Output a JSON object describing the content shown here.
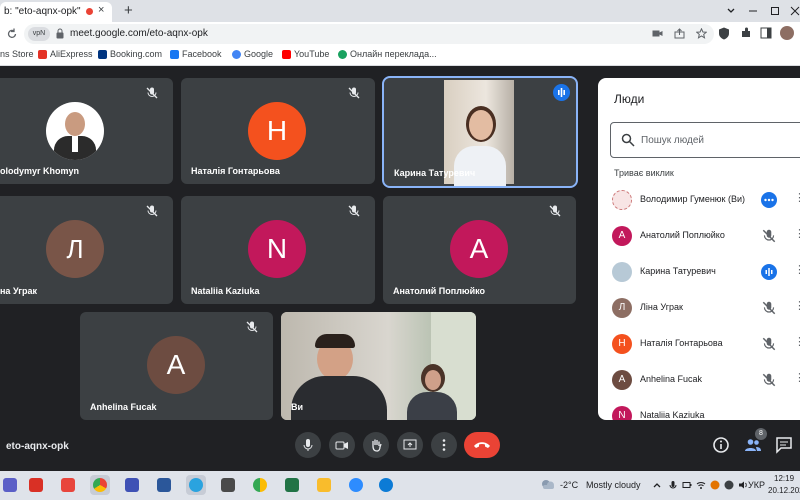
{
  "browser": {
    "tab_title": "b: \"eto-aqnx-opk\"",
    "new_tab_glyph": "+",
    "close_glyph": "×",
    "url": "meet.google.com/eto-aqnx-opk",
    "site_chip": "vpN",
    "bookmarks": [
      {
        "label": "ns Store",
        "color": "#ffffff"
      },
      {
        "label": "AliExpress",
        "color": "#e43226"
      },
      {
        "label": "Booking.com",
        "color": "#003580"
      },
      {
        "label": "Facebook",
        "color": "#1877f2"
      },
      {
        "label": "Google",
        "color": "#4285f4"
      },
      {
        "label": "YouTube",
        "color": "#ff0000"
      },
      {
        "label": "Онлайн перекладa...",
        "color": "#1aa260"
      }
    ]
  },
  "meet": {
    "meeting_code": "eto-aqnx-opk",
    "tiles": [
      {
        "name": "olodymyr Khomyn",
        "initial": "",
        "avatar_color": "#ffffff",
        "muted": true
      },
      {
        "name": "Наталія Гонтарьова",
        "initial": "H",
        "avatar_color": "#f4511e",
        "muted": true
      },
      {
        "name": "Карина Татуревич",
        "initial": "",
        "avatar_color": "",
        "muted": false,
        "speaking": true
      },
      {
        "name": "на Уграк",
        "initial": "Л",
        "avatar_color": "#795548",
        "muted": true
      },
      {
        "name": "Nataliia Kaziuka",
        "initial": "N",
        "avatar_color": "#c2185b",
        "muted": true
      },
      {
        "name": "Анатолий Поплюйко",
        "initial": "A",
        "avatar_color": "#c2185b",
        "muted": true
      },
      {
        "name": "Anhelina Fucak",
        "initial": "A",
        "avatar_color": "#6d4c41",
        "muted": true
      },
      {
        "name": "Ви",
        "initial": "",
        "avatar_color": "",
        "muted": false
      }
    ],
    "participant_count": "8"
  },
  "people_panel": {
    "title": "Люди",
    "search_placeholder": "Пошук людей",
    "section_label": "Триває виклик",
    "participants": [
      {
        "name": "Володимир Гуменюк (Ви)",
        "initial": "",
        "avatar_color": "#f8e5e5",
        "status": "more"
      },
      {
        "name": "Анатолий Поплюйко",
        "initial": "A",
        "avatar_color": "#c2185b",
        "status": "mic-off"
      },
      {
        "name": "Карина Татуревич",
        "initial": "",
        "avatar_color": "#b7c9d6",
        "status": "speaking"
      },
      {
        "name": "Ліна Уграк",
        "initial": "Л",
        "avatar_color": "#8d6e63",
        "status": "mic-off"
      },
      {
        "name": "Наталія Гонтарьова",
        "initial": "H",
        "avatar_color": "#f4511e",
        "status": "mic-off"
      },
      {
        "name": "Anhelina Fucak",
        "initial": "A",
        "avatar_color": "#6d4c41",
        "status": "mic-off"
      },
      {
        "name": "Nataliia Kaziuka",
        "initial": "N",
        "avatar_color": "#c2185b",
        "status": "mic-off"
      }
    ]
  },
  "taskbar": {
    "weather_temp": "-2°C",
    "weather_text": "Mostly cloudy",
    "language": "УКР",
    "time": "12:19",
    "date": "20.12.202",
    "apps": [
      {
        "name": "teams",
        "color": "#5b5fc7"
      },
      {
        "name": "app-red",
        "color": "#d93025"
      },
      {
        "name": "pdf",
        "color": "#e8453c"
      },
      {
        "name": "chrome",
        "color": "#34a853"
      },
      {
        "name": "save",
        "color": "#3f51b5"
      },
      {
        "name": "word",
        "color": "#2b579a"
      },
      {
        "name": "telegram",
        "color": "#2aa3df"
      },
      {
        "name": "calculator",
        "color": "#4a4a4a"
      },
      {
        "name": "chrome-2",
        "color": "#fbbc04"
      },
      {
        "name": "excel",
        "color": "#217346"
      },
      {
        "name": "explorer",
        "color": "#f9bc2c"
      },
      {
        "name": "zoom",
        "color": "#2d8cff"
      },
      {
        "name": "edge",
        "color": "#0c7bd6"
      }
    ]
  }
}
